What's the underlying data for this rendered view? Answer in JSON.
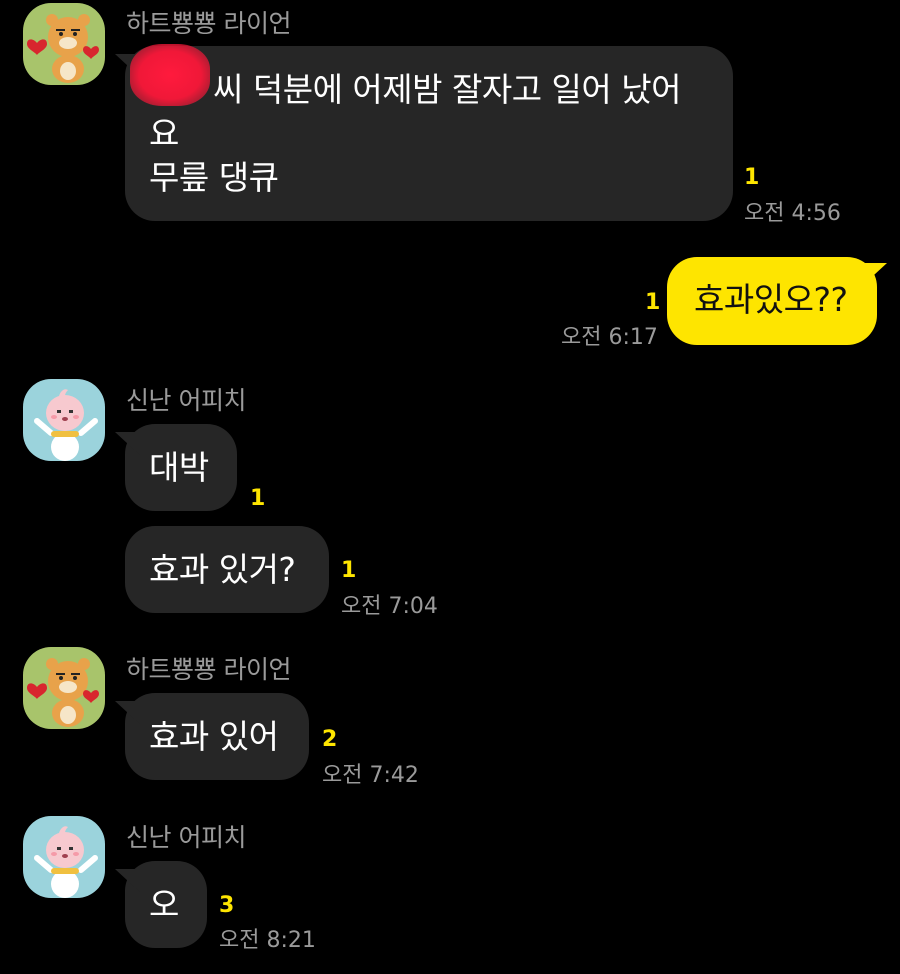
{
  "colors": {
    "background": "#000000",
    "bubble_other": "#262626",
    "bubble_mine": "#fee500",
    "unread_count": "#fee500",
    "meta_text": "#9a9a9a",
    "redaction": "#f01838"
  },
  "messages": [
    {
      "sender": "하트뿅뿅 라이언",
      "avatar": "ryan-avatar-icon",
      "lines": [
        "씨  덕분에 어제밤 잘자고 일어 났어",
        "요",
        "무릎 댕큐"
      ],
      "unread": "1",
      "time": "오전 4:56"
    },
    {
      "sender": "",
      "mine": true,
      "lines": [
        "효과있오??"
      ],
      "unread": "1",
      "time": "오전 6:17"
    },
    {
      "sender": "신난 어피치",
      "avatar": "apeach-avatar-icon",
      "lines": [
        "대박"
      ],
      "unread": "1",
      "time": ""
    },
    {
      "sender": "신난 어피치",
      "lines": [
        "효과 있거?"
      ],
      "unread": "1",
      "time": "오전 7:04"
    },
    {
      "sender": "하트뿅뿅 라이언",
      "avatar": "ryan-avatar-icon",
      "lines": [
        "효과 있어"
      ],
      "unread": "2",
      "time": "오전 7:42"
    },
    {
      "sender": "신난 어피치",
      "avatar": "apeach-avatar-icon",
      "lines": [
        "오"
      ],
      "unread": "3",
      "time": "오전 8:21"
    }
  ]
}
